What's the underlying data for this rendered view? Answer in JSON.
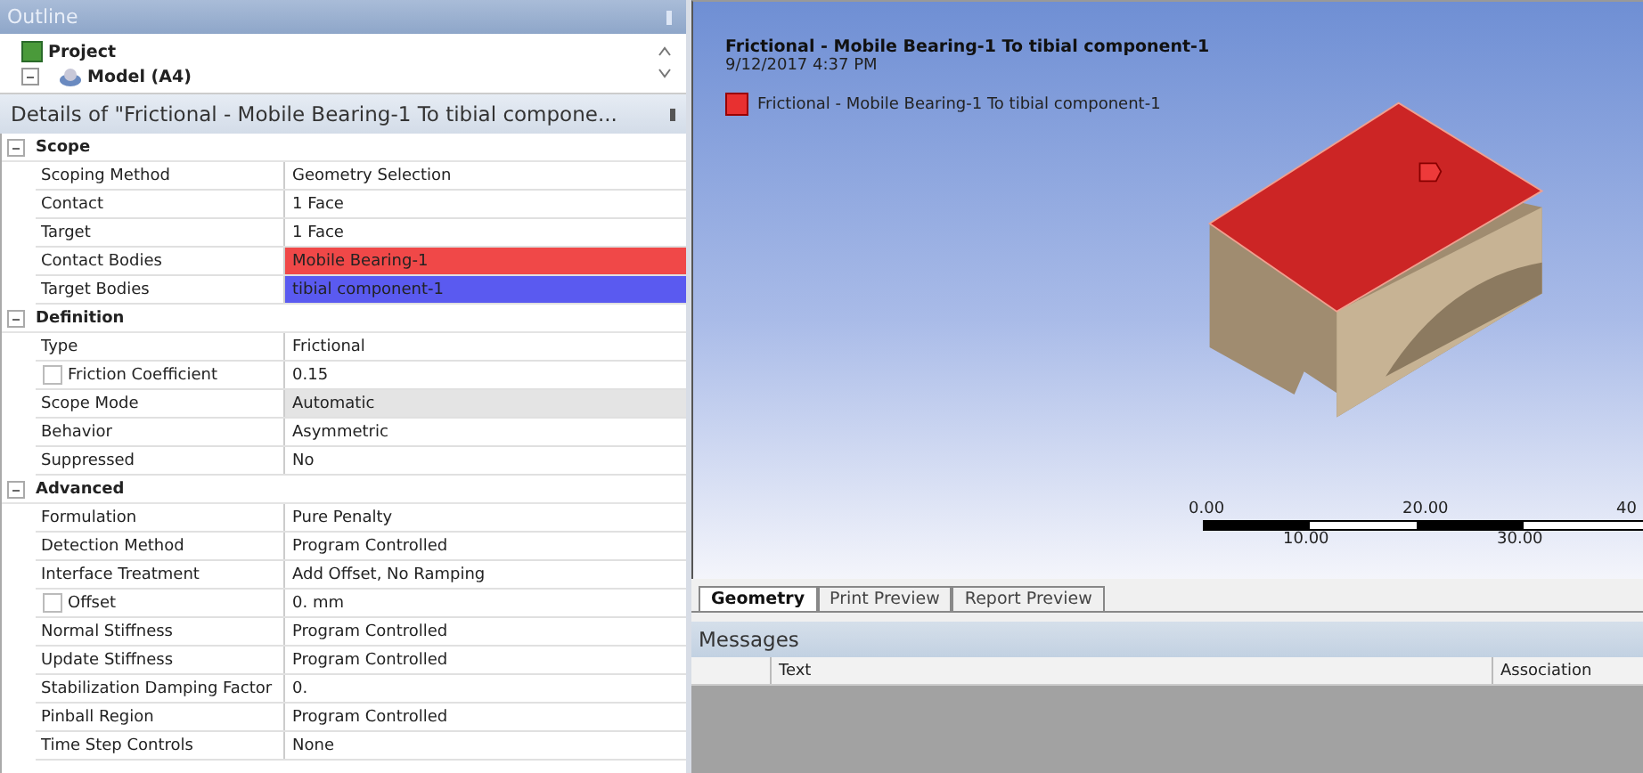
{
  "outline": {
    "title": "Outline",
    "tree": [
      {
        "label": "Project",
        "children": [
          {
            "label": "Model (A4)",
            "expanded": true
          }
        ]
      }
    ]
  },
  "details": {
    "title": "Details of \"Frictional - Mobile Bearing-1 To tibial compone...",
    "groups": [
      {
        "title": "Scope",
        "expanded": true,
        "rows": [
          {
            "kind": "plain",
            "name": "Scoping Method",
            "value": "Geometry Selection",
            "shaded": false
          },
          {
            "kind": "plain",
            "name": "Contact",
            "value": "1 Face",
            "shaded": false
          },
          {
            "kind": "plain",
            "name": "Target",
            "value": "1 Face",
            "shaded": false
          },
          {
            "kind": "plain",
            "name": "Contact Bodies",
            "value": "Mobile Bearing-1",
            "shaded": false,
            "color": "#f04848"
          },
          {
            "kind": "plain",
            "name": "Target Bodies",
            "value": "tibial component-1",
            "shaded": false,
            "color": "#5a5af0"
          }
        ]
      },
      {
        "title": "Definition",
        "expanded": true,
        "rows": [
          {
            "kind": "plain",
            "name": "Type",
            "value": "Frictional",
            "shaded": false
          },
          {
            "kind": "check",
            "name": "Friction Coefficient",
            "value": "0.15",
            "shaded": false,
            "checked": false
          },
          {
            "kind": "plain",
            "name": "Scope Mode",
            "value": "Automatic",
            "shaded": true
          },
          {
            "kind": "plain",
            "name": "Behavior",
            "value": "Asymmetric",
            "shaded": false
          },
          {
            "kind": "plain",
            "name": "Suppressed",
            "value": "No",
            "shaded": false
          }
        ]
      },
      {
        "title": "Advanced",
        "expanded": true,
        "rows": [
          {
            "kind": "plain",
            "name": "Formulation",
            "value": "Pure Penalty",
            "shaded": false
          },
          {
            "kind": "plain",
            "name": "Detection Method",
            "value": "Program Controlled",
            "shaded": false
          },
          {
            "kind": "plain",
            "name": "Interface Treatment",
            "value": "Add Offset, No Ramping",
            "shaded": false
          },
          {
            "kind": "check",
            "name": "Offset",
            "value": "0. mm",
            "shaded": false,
            "checked": false
          },
          {
            "kind": "plain",
            "name": "Normal Stiffness",
            "value": "Program Controlled",
            "shaded": false
          },
          {
            "kind": "plain",
            "name": "Update Stiffness",
            "value": "Program Controlled",
            "shaded": false
          },
          {
            "kind": "plain",
            "name": "Stabilization Damping Factor",
            "value": "0.",
            "shaded": false
          },
          {
            "kind": "plain",
            "name": "Pinball Region",
            "value": "Program Controlled",
            "shaded": false
          },
          {
            "kind": "plain",
            "name": "Time Step Controls",
            "value": "None",
            "shaded": false
          }
        ]
      }
    ]
  },
  "viewport": {
    "title": "Frictional - Mobile Bearing-1 To tibial component-1",
    "date": "9/12/2017 4:37 PM",
    "legend": [
      {
        "label": "Frictional - Mobile Bearing-1 To tibial component-1",
        "color": "#e83030"
      }
    ],
    "scale": {
      "top_labels": [
        "0.00",
        "20.00",
        "40"
      ],
      "bottom_labels": [
        "10.00",
        "30.00"
      ]
    }
  },
  "tabs": [
    {
      "label": "Geometry",
      "selected": true
    },
    {
      "label": "Print Preview",
      "selected": false
    },
    {
      "label": "Report Preview",
      "selected": false
    }
  ],
  "messages": {
    "title": "Messages",
    "columns": [
      "Text",
      "Association"
    ]
  }
}
